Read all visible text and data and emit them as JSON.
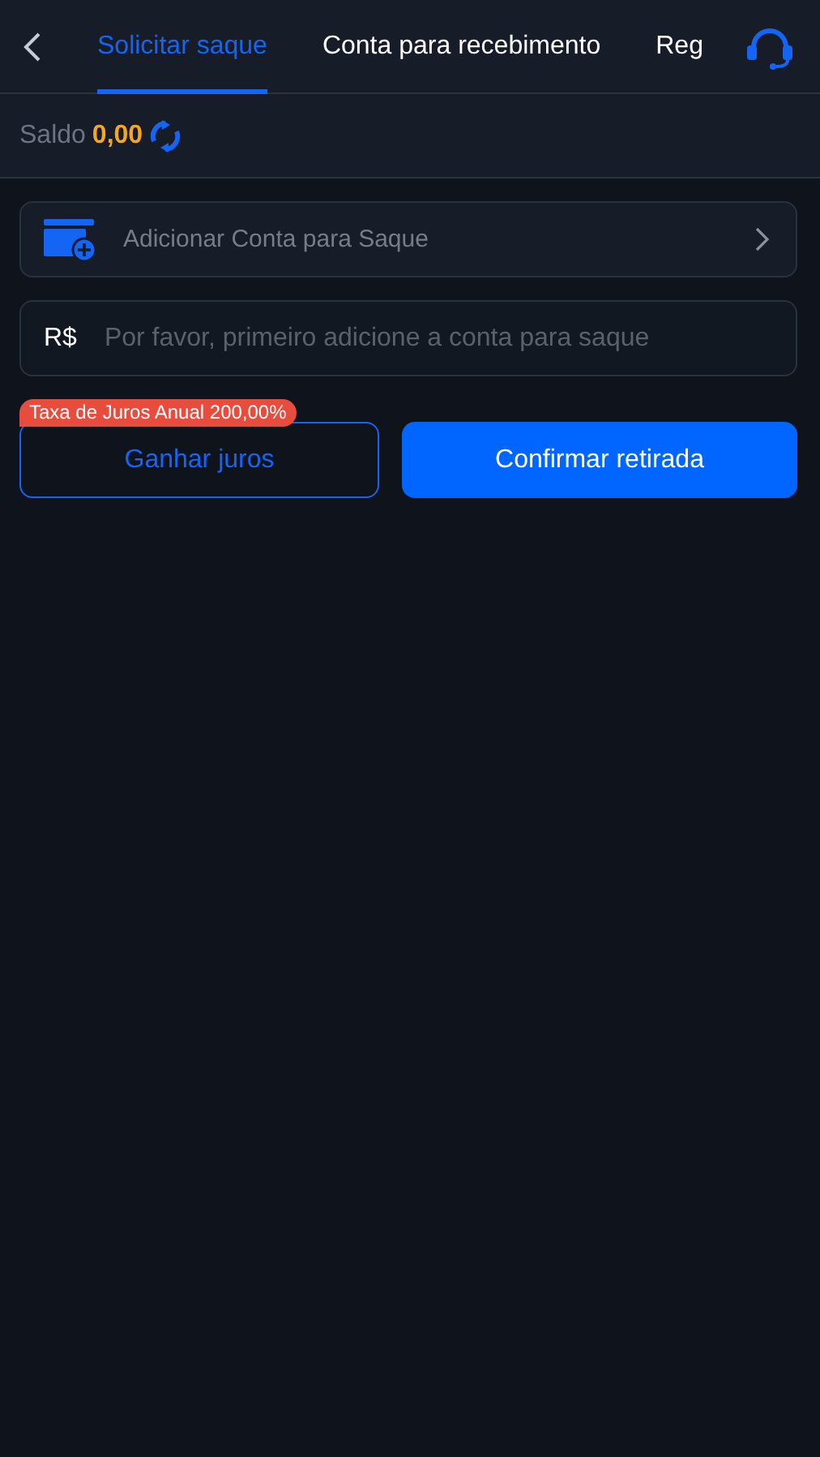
{
  "header": {
    "tabs": [
      {
        "label": "Solicitar saque",
        "selected": true
      },
      {
        "label": "Conta para recebimento",
        "selected": false
      },
      {
        "label": "Reg",
        "selected": false
      }
    ]
  },
  "balance": {
    "label": "Saldo",
    "amount": "0,00"
  },
  "account_row": {
    "label": "Adicionar Conta para Saque"
  },
  "amount_field": {
    "currency": "R$",
    "placeholder": "Por favor, primeiro adicione a conta para saque"
  },
  "interest_badge": "Taxa de Juros Anual 200,00%",
  "buttons": [
    {
      "label": "Ganhar juros",
      "kind": "outline"
    },
    {
      "label": "Confirmar retirada",
      "kind": "primary"
    }
  ]
}
